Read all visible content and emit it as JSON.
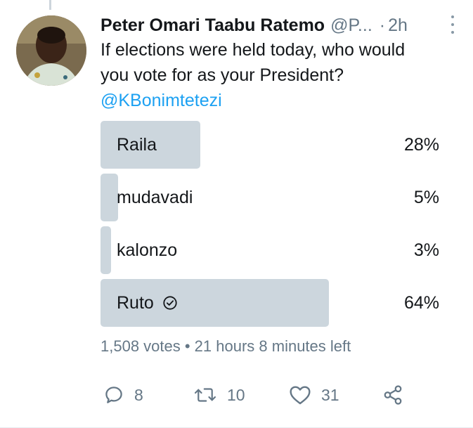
{
  "tweet": {
    "author_name": "Peter Omari Taabu Ratemo",
    "handle": "@P...",
    "separator": "·",
    "time": "2h",
    "text_line1": "If elections were held today, who would",
    "text_line2": "you vote for as your President?",
    "mention": "@KBonimtetezi"
  },
  "poll": {
    "options": [
      {
        "label": "Raila",
        "percent_text": "28%",
        "percent": 28
      },
      {
        "label": "mudavadi",
        "percent_text": "5%",
        "percent": 5
      },
      {
        "label": "kalonzo",
        "percent_text": "3%",
        "percent": 3
      },
      {
        "label": "Ruto",
        "percent_text": "64%",
        "percent": 64,
        "selected": true
      }
    ],
    "meta": "1,508 votes • 21 hours 8 minutes left"
  },
  "actions": {
    "reply_count": "8",
    "retweet_count": "10",
    "like_count": "31"
  },
  "colors": {
    "accent": "#1da1f2",
    "bar": "#ccd6dd",
    "secondary_text": "#657786"
  },
  "icons": [
    "reply-icon",
    "retweet-icon",
    "like-icon",
    "share-icon",
    "check-circle-icon",
    "more-vertical-icon"
  ]
}
